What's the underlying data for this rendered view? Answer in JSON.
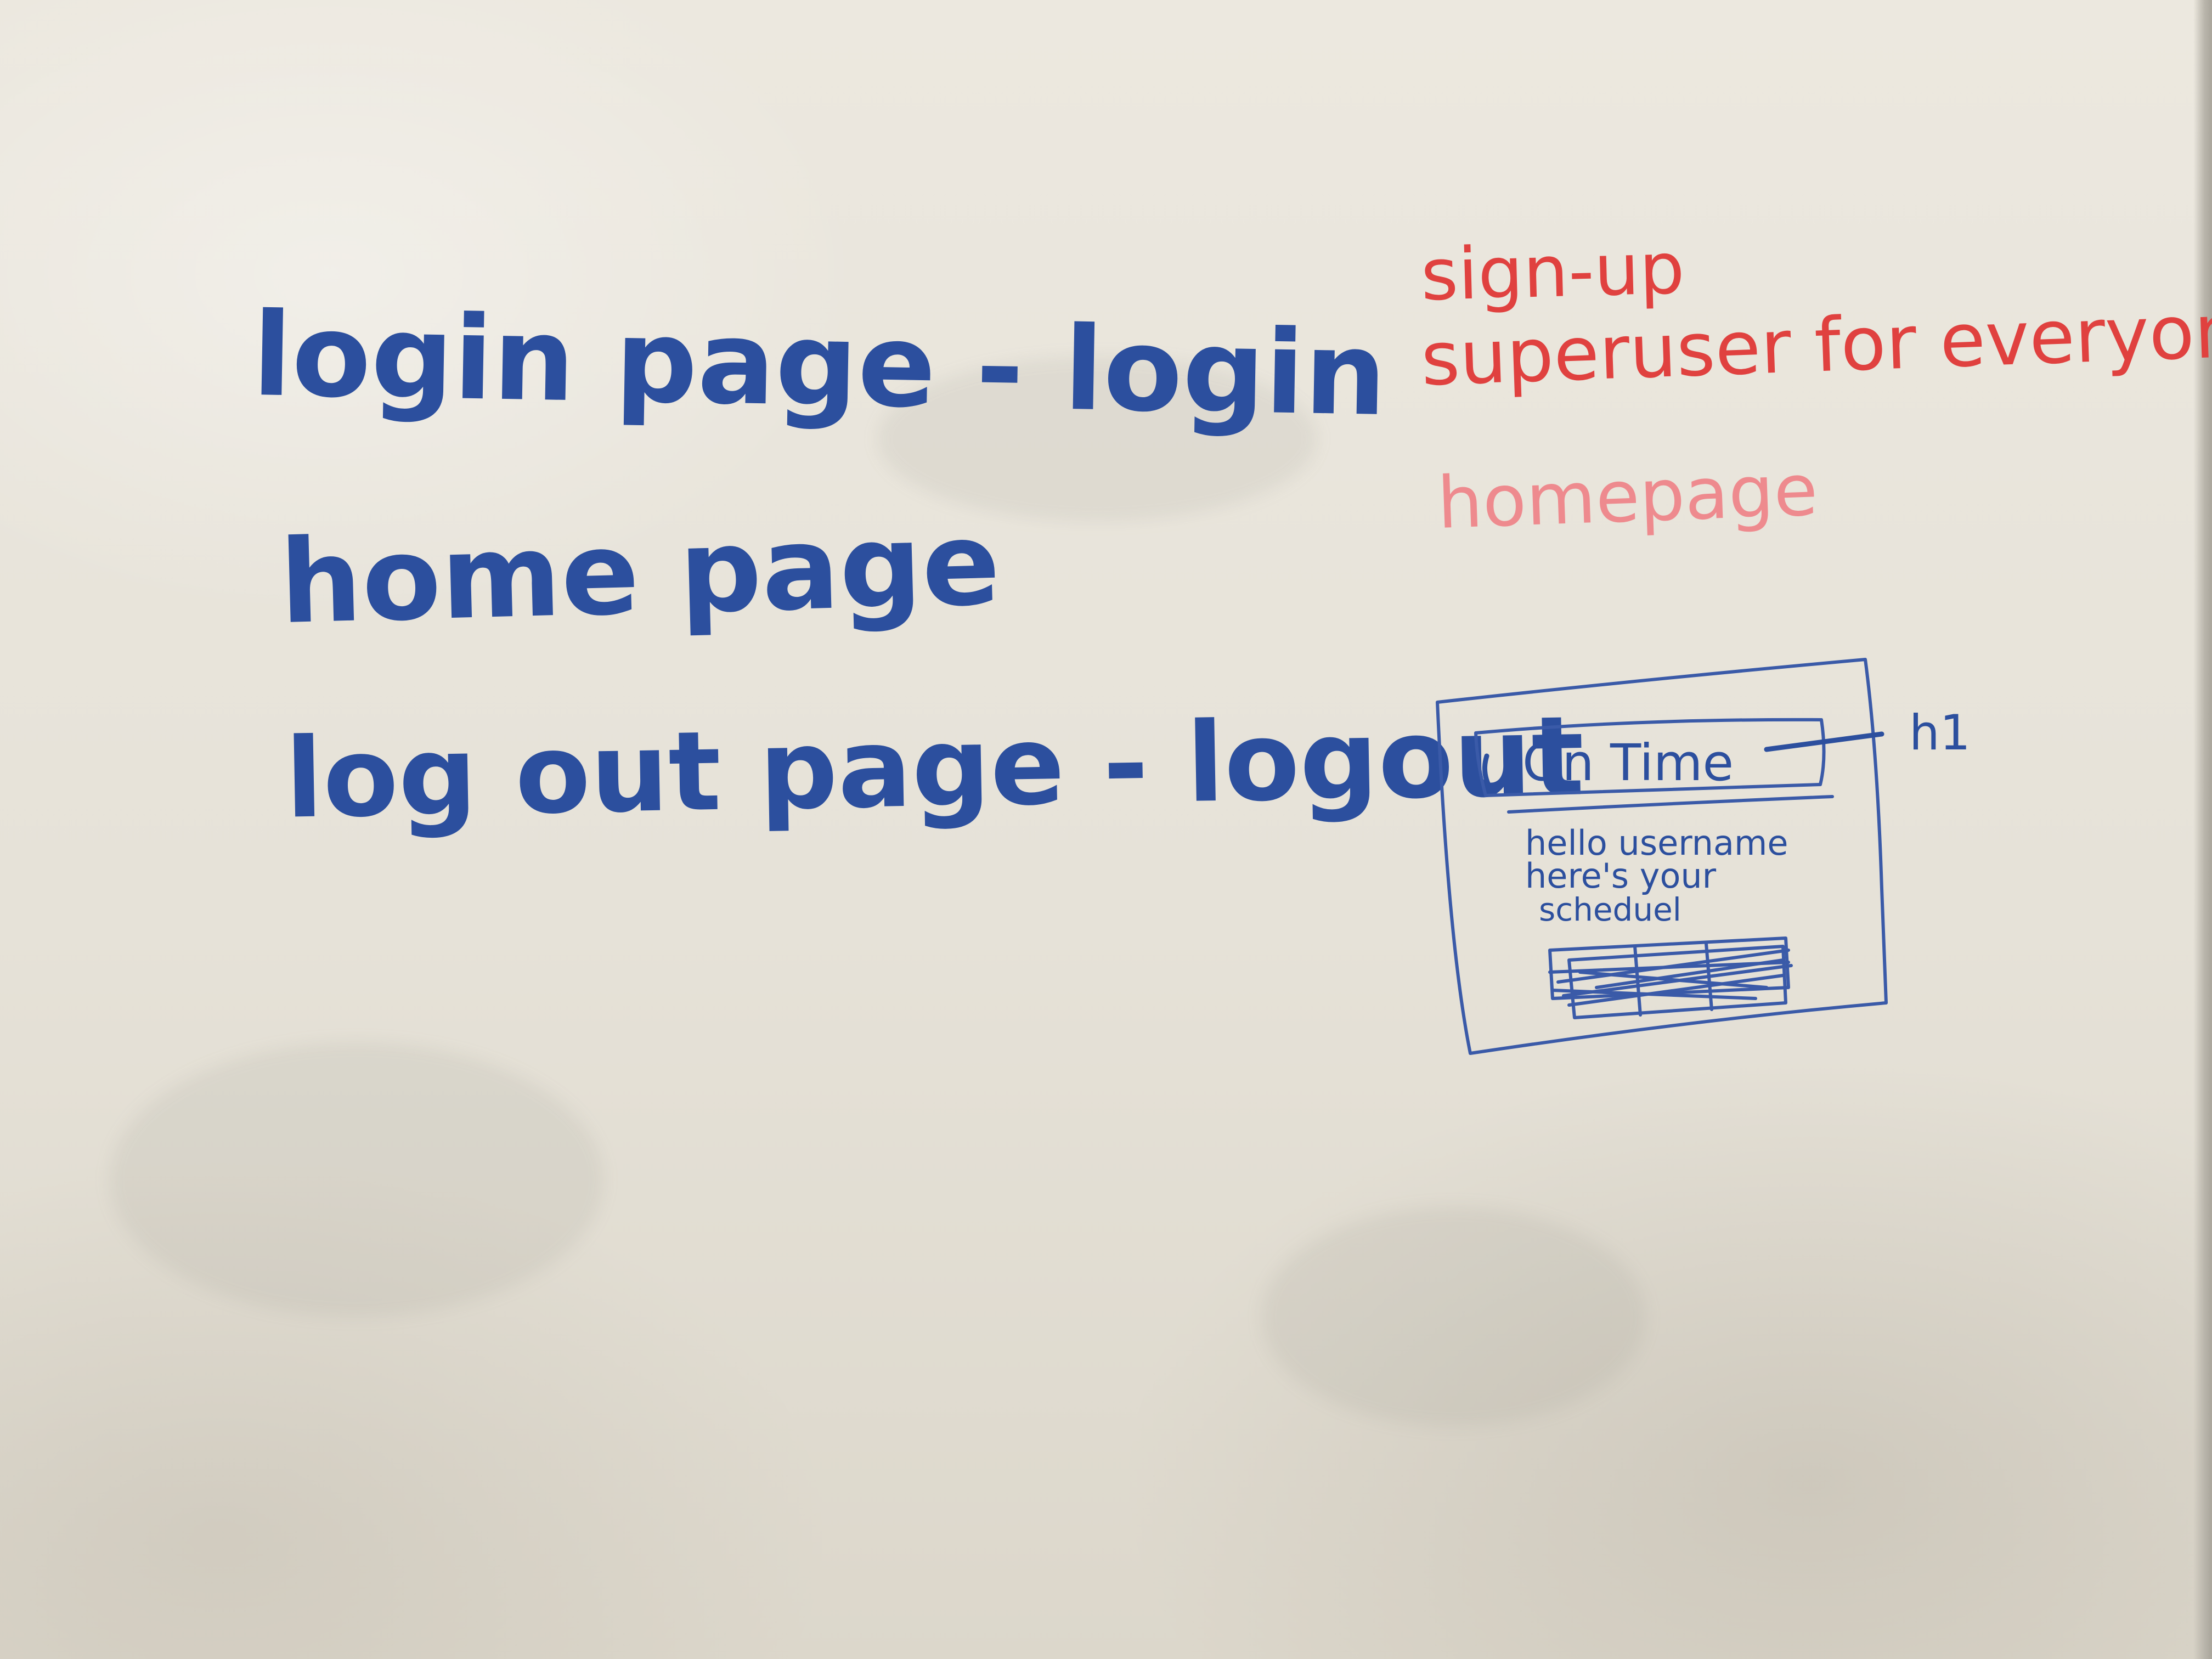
{
  "notes": {
    "login_page": "login page - login",
    "home_page": "home page",
    "logout_page": "log out page - logout",
    "signup": "sign-up",
    "superuser": "superuser for everyone",
    "homepage_label": "homepage"
  },
  "sketch": {
    "header_text": "On Time",
    "header_tag": "h1",
    "greeting": "hello username",
    "subtitle_line1": "here's your",
    "subtitle_line2": "scheduel"
  },
  "colors": {
    "blue_marker": "#2c4f9e",
    "red_marker": "#e0413f",
    "faded_red_marker": "#ee8a8e",
    "board": "#e9e5dc"
  }
}
